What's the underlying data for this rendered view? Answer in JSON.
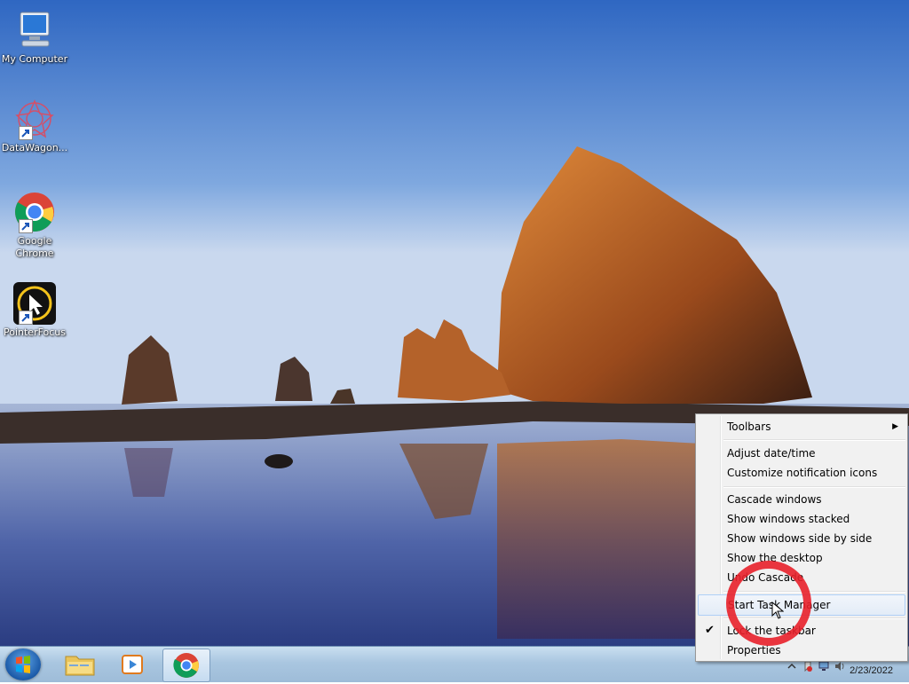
{
  "desktop": {
    "icons": [
      {
        "label": "My Computer",
        "icon": "computer-icon"
      },
      {
        "label": "DataWagon...",
        "icon": "datawagon-icon"
      },
      {
        "label": "Google Chrome",
        "icon": "chrome-icon"
      },
      {
        "label": "PointerFocus",
        "icon": "pointerfocus-icon"
      }
    ]
  },
  "taskbar": {
    "start": "windows-start-icon",
    "pinned": [
      {
        "name": "file-explorer",
        "icon": "folder-icon"
      },
      {
        "name": "media-player",
        "icon": "media-player-icon"
      },
      {
        "name": "google-chrome",
        "icon": "chrome-icon",
        "active": true
      }
    ],
    "clock": {
      "date": "2/23/2022"
    }
  },
  "context_menu": {
    "items": [
      {
        "label": "Toolbars",
        "submenu": true
      },
      {
        "label": "Adjust date/time"
      },
      {
        "label": "Customize notification icons"
      },
      {
        "label": "Cascade windows"
      },
      {
        "label": "Show windows stacked"
      },
      {
        "label": "Show windows side by side"
      },
      {
        "label": "Show the desktop"
      },
      {
        "label": "Undo Cascade"
      },
      {
        "label": "Start Task Manager",
        "hovered": true
      },
      {
        "label": "Lock the taskbar",
        "checked": true
      },
      {
        "label": "Properties"
      }
    ]
  },
  "colors": {
    "annotation_ring": "#e8202a",
    "menu_hover_border": "#aecff7"
  }
}
